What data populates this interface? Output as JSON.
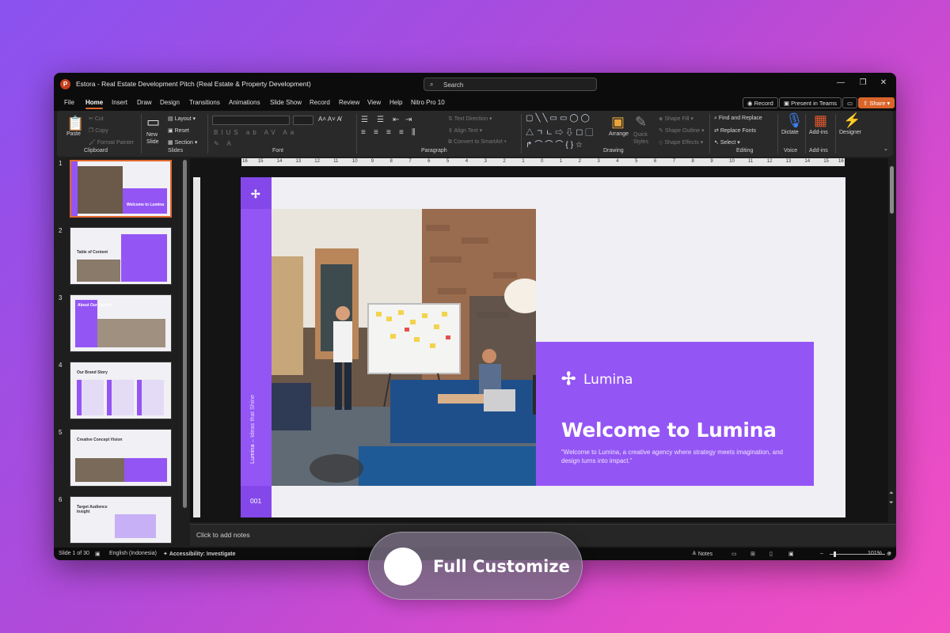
{
  "window": {
    "title": "Estora - Real Estate Development Pitch  (Real Estate & Property Development)",
    "app_logo": "P",
    "search_placeholder": "Search",
    "controls": {
      "minimize": "—",
      "maximize": "❐",
      "close": "✕"
    }
  },
  "menu": {
    "tabs": [
      "File",
      "Home",
      "Insert",
      "Draw",
      "Design",
      "Transitions",
      "Animations",
      "Slide Show",
      "Record",
      "Review",
      "View",
      "Help",
      "Nitro Pro 10"
    ],
    "active_tab": "Home",
    "record": "Record",
    "present_teams": "Present in Teams",
    "share": "Share"
  },
  "ribbon": {
    "clipboard": {
      "label": "Clipboard",
      "paste": "Paste",
      "cut": "Cut",
      "copy": "Copy",
      "format_painter": "Format Painter"
    },
    "slides": {
      "label": "Slides",
      "new_slide": "New Slide",
      "layout": "Layout",
      "reset": "Reset",
      "section": "Section"
    },
    "font": {
      "label": "Font"
    },
    "paragraph": {
      "label": "Paragraph",
      "text_direction": "Text Direction",
      "align_text": "Align Text",
      "convert_smartart": "Convert to SmartArt"
    },
    "drawing": {
      "label": "Drawing",
      "arrange": "Arrange",
      "quick_styles": "Quick Styles",
      "shape_fill": "Shape Fill",
      "shape_outline": "Shape Outline",
      "shape_effects": "Shape Effects"
    },
    "editing": {
      "label": "Editing",
      "find_replace": "Find and Replace",
      "replace_fonts": "Replace Fonts",
      "select": "Select"
    },
    "voice": {
      "label": "Voice",
      "dictate": "Dictate"
    },
    "addins": {
      "label": "Add-ins",
      "addins": "Add-ins"
    },
    "designer": {
      "designer": "Designer"
    }
  },
  "thumbnails": [
    {
      "num": "1",
      "title": "Welcome to Lumina",
      "selected": true
    },
    {
      "num": "2",
      "title": "Table of Content",
      "selected": false
    },
    {
      "num": "3",
      "title": "About Our Agency",
      "selected": false
    },
    {
      "num": "4",
      "title": "Our Brand Story",
      "selected": false
    },
    {
      "num": "5",
      "title": "Creative Concept Vision",
      "selected": false
    },
    {
      "num": "6",
      "title": "Target Audience Insight",
      "selected": false
    }
  ],
  "ruler": {
    "marks": [
      "16",
      "15",
      "14",
      "13",
      "12",
      "11",
      "10",
      "9",
      "8",
      "7",
      "6",
      "5",
      "4",
      "3",
      "2",
      "1",
      "0",
      "1",
      "2",
      "3",
      "4",
      "5",
      "6",
      "7",
      "8",
      "9",
      "10",
      "11",
      "12",
      "13",
      "14",
      "15",
      "16"
    ]
  },
  "slide": {
    "logo_word": "Lumina",
    "title": "Welcome to Lumina",
    "subtitle": "“Welcome to Lumina, a creative agency where strategy meets imagination, and design turns into impact.”",
    "vertical_brand": "Lumina",
    "vertical_tagline": "– Ideas that Shine",
    "number": "001",
    "accent": "#9455f5"
  },
  "notes": {
    "placeholder": "Click to add notes"
  },
  "status": {
    "slide_info": "Slide 1 of 30",
    "language": "English (Indonesia)",
    "accessibility": "Accessibility: Investigate",
    "notes": "Notes",
    "zoom": "101%"
  },
  "overlay": {
    "label": "Full Customize"
  }
}
